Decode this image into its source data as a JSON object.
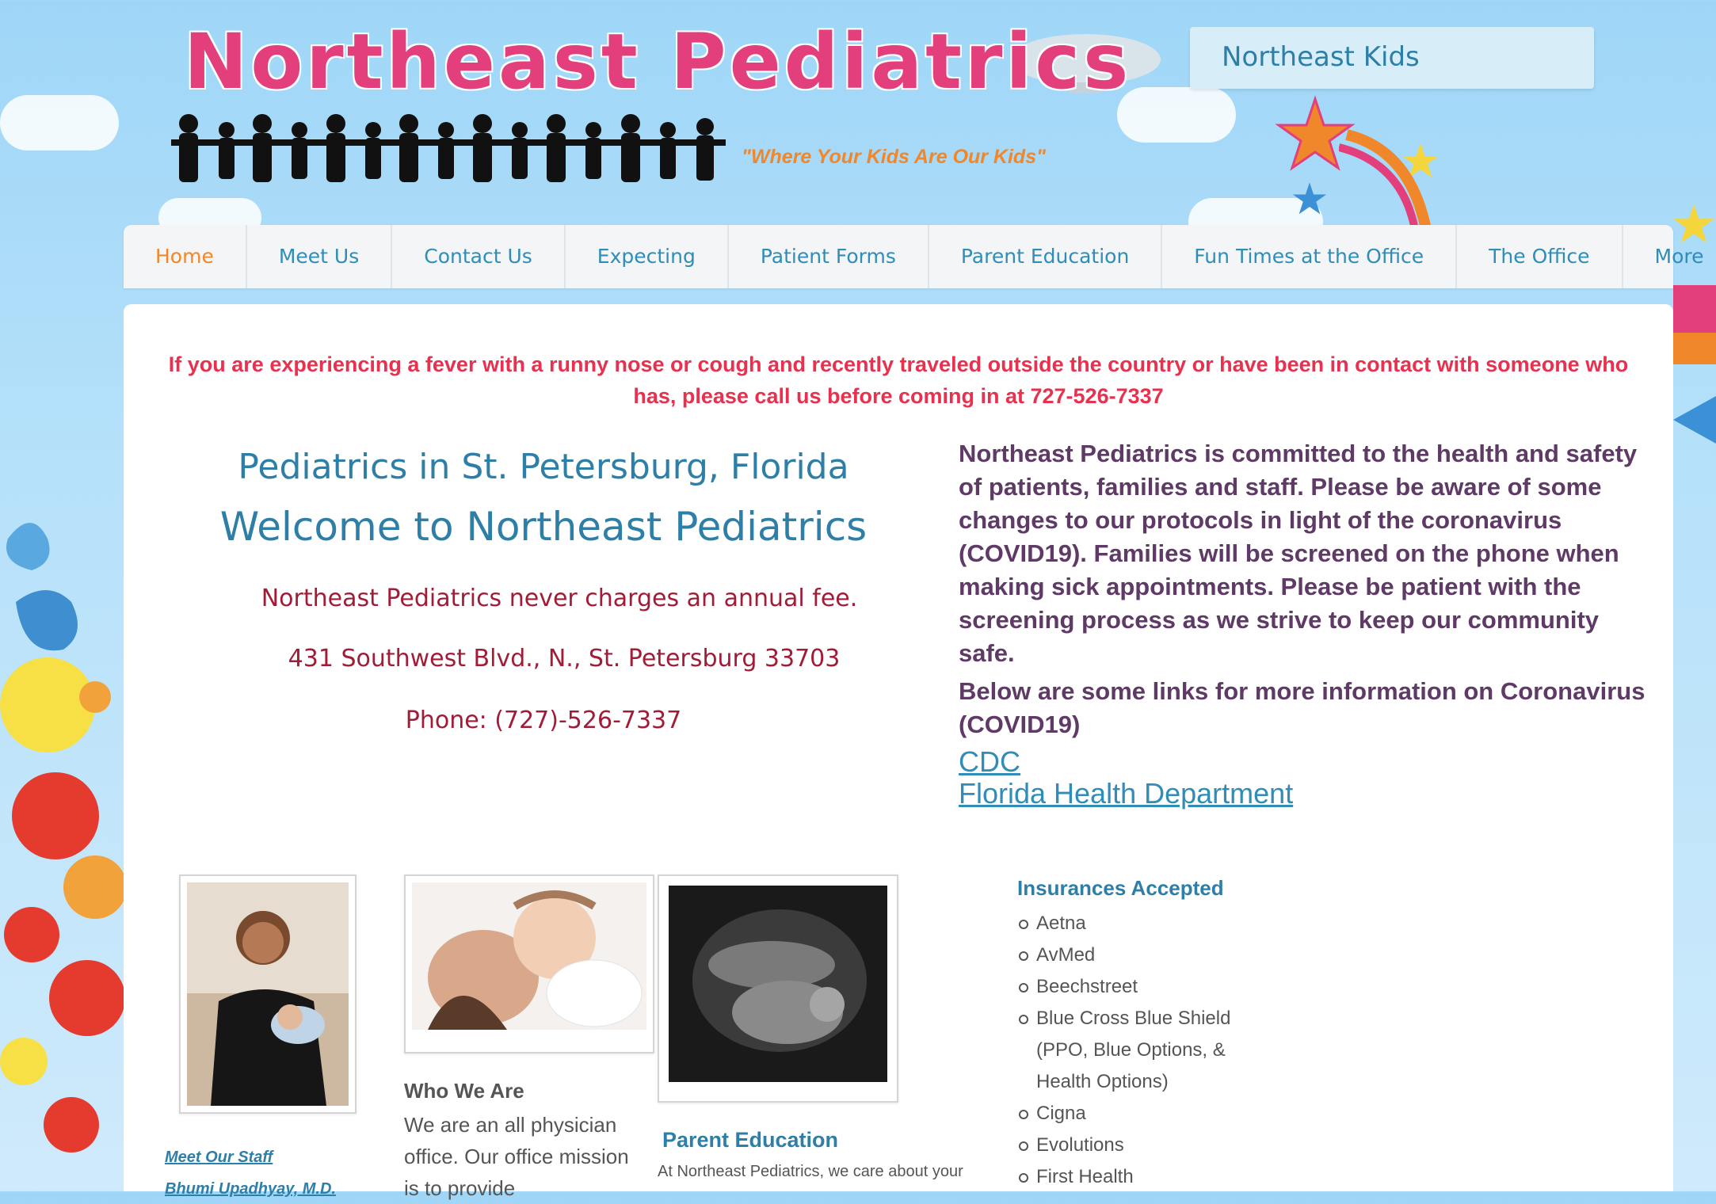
{
  "header": {
    "title": "Northeast Pediatrics",
    "tagline": "\"Where Your Kids Are Our Kids\"",
    "box_label": "Northeast Kids"
  },
  "nav": {
    "items": [
      "Home",
      "Meet Us",
      "Contact Us",
      "Expecting",
      "Patient Forms",
      "Parent Education",
      "Fun Times at the Office",
      "The Office",
      "More"
    ],
    "active": "Home"
  },
  "alert": "If you are experiencing a fever with a runny nose or cough and recently traveled outside the country or have been in contact with someone who has, please call us before coming in at 727-526-7337",
  "welcome": {
    "subtitle": "Pediatrics in St. Petersburg, Florida",
    "title": "Welcome to Northeast Pediatrics",
    "fee": "Northeast Pediatrics never charges an annual fee.",
    "address": "431 Southwest Blvd., N., St. Petersburg 33703",
    "phone": "Phone: (727)-526-7337"
  },
  "covid": {
    "paragraph": "Northeast Pediatrics is committed to the health and safety of patients, families and staff. Please be aware of some changes to our protocols in light of the coronavirus (COVID19). Families will be screened on the phone when making sick appointments. Please be patient with the screening process as we strive to keep our community safe.",
    "links_intro": "Below are some links for more information on Coronavirus (COVID19)",
    "links": [
      "CDC",
      "Florida Health Department"
    ]
  },
  "staff": {
    "link": "Meet Our Staff",
    "name_partial": "Bhumi Upadhyay, M.D."
  },
  "who_we_are": {
    "title": "Who We Are",
    "body": "We are an all physician office. Our office mission is to provide"
  },
  "parent_education": {
    "title": "Parent Education",
    "body": "At Northeast Pediatrics, we care about your"
  },
  "insurances": {
    "title": "Insurances Accepted",
    "items": [
      "Aetna",
      "AvMed",
      "Beechstreet",
      "Blue Cross Blue Shield (PPO, Blue Options, & Health Options)",
      "Cigna",
      "Evolutions",
      "First Health"
    ]
  },
  "colors": {
    "brand_pink": "#e23f7c",
    "accent_orange": "#f0872a",
    "link_blue": "#2e7fa8",
    "alert_red": "#e8304f",
    "covid_purple": "#5f3a66",
    "address_red": "#a01c37"
  }
}
